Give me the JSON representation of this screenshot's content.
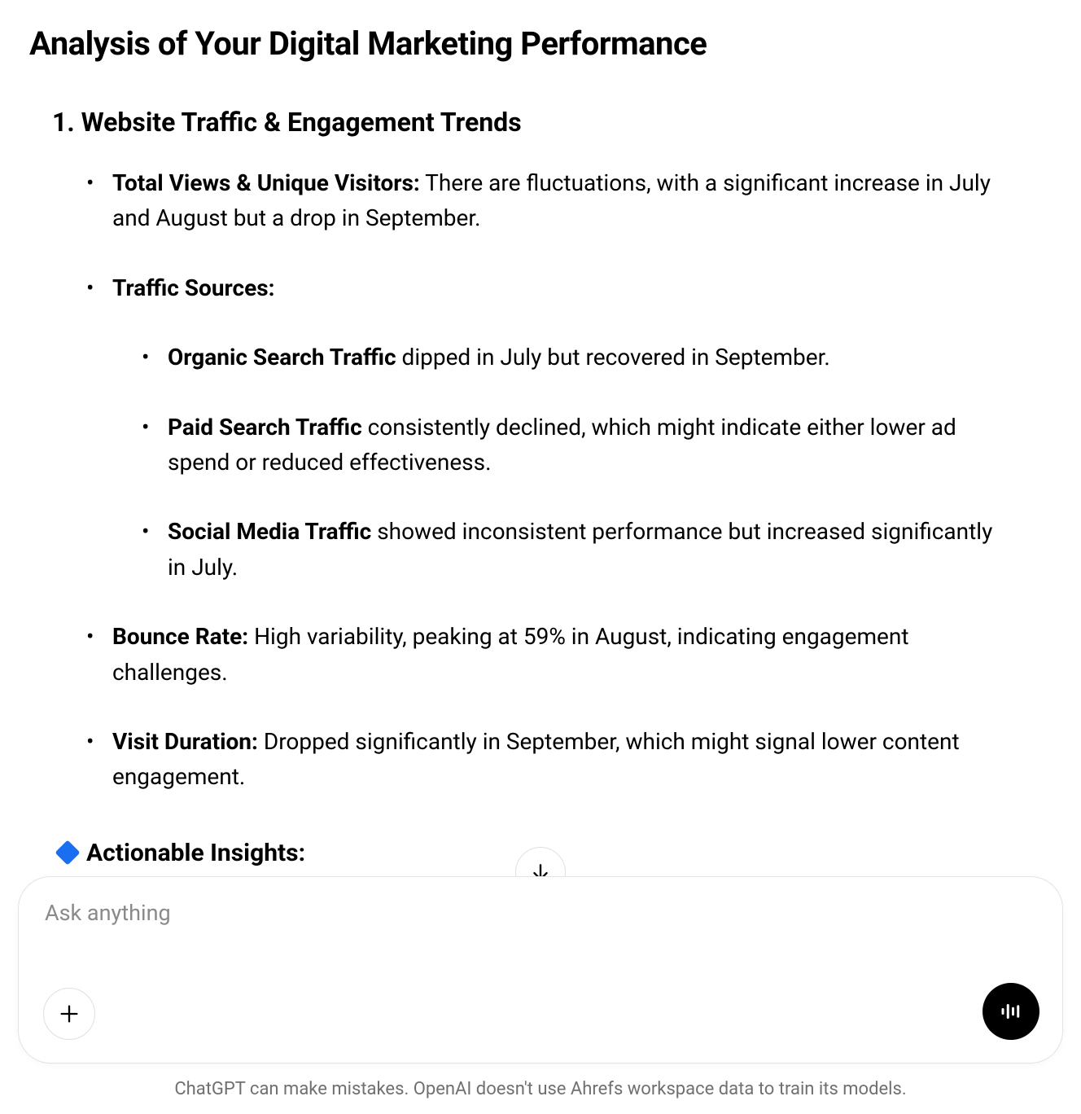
{
  "title": "Analysis of Your Digital Marketing Performance",
  "section1": {
    "heading": "1. Website Traffic & Engagement Trends",
    "items": {
      "total_views": {
        "label": "Total Views & Unique Visitors:",
        "text": " There are fluctuations, with a significant increase in July and August but a drop in September."
      },
      "traffic_sources": {
        "label": "Traffic Sources:",
        "sub": {
          "organic": {
            "label": "Organic Search Traffic",
            "text": " dipped in July but recovered in September."
          },
          "paid": {
            "label": "Paid Search Traffic",
            "text": " consistently declined, which might indicate either lower ad spend or reduced effectiveness."
          },
          "social": {
            "label": "Social Media Traffic",
            "text": " showed inconsistent performance but increased significantly in July."
          }
        }
      },
      "bounce": {
        "label": "Bounce Rate:",
        "text": " High variability, peaking at 59% in August, indicating engagement challenges."
      },
      "duration": {
        "label": "Visit Duration:",
        "text": " Dropped significantly in September, which might signal lower content engagement."
      }
    }
  },
  "insights_label": "Actionable Insights:",
  "input": {
    "placeholder": "Ask anything"
  },
  "disclaimer": "ChatGPT can make mistakes. OpenAI doesn't use Ahrefs workspace data to train its models."
}
